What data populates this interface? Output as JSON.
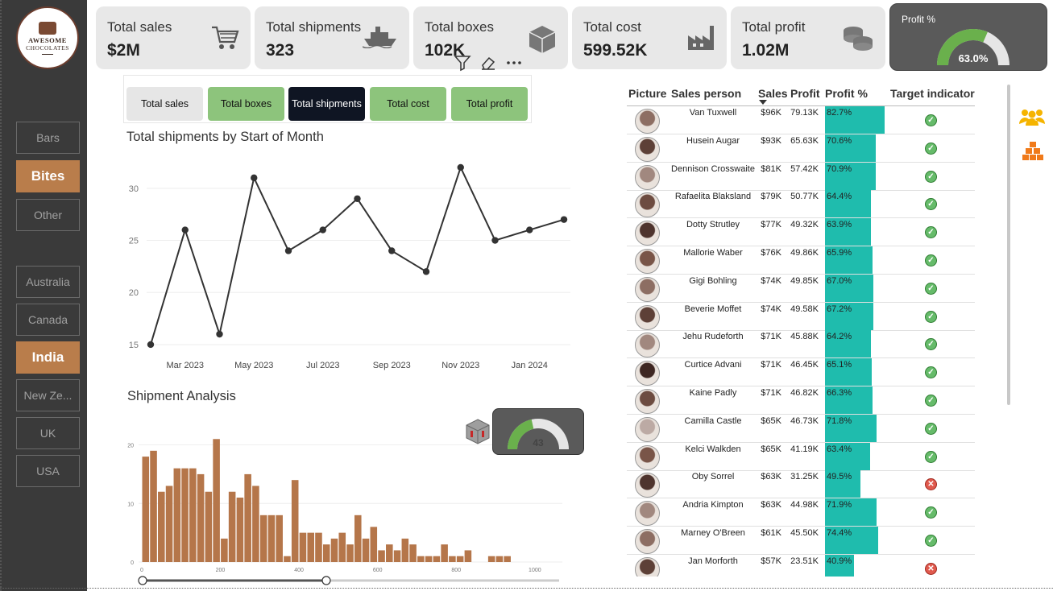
{
  "logo": {
    "line1": "AWESOME",
    "line2": "CHOCOLATES"
  },
  "product_slicer": [
    {
      "label": "Bars",
      "selected": false
    },
    {
      "label": "Bites",
      "selected": true
    },
    {
      "label": "Other",
      "selected": false
    }
  ],
  "country_slicer": [
    {
      "label": "Australia",
      "selected": false
    },
    {
      "label": "Canada",
      "selected": false
    },
    {
      "label": "India",
      "selected": true
    },
    {
      "label": "New Ze...",
      "selected": false
    },
    {
      "label": "UK",
      "selected": false
    },
    {
      "label": "USA",
      "selected": false
    }
  ],
  "kpis": [
    {
      "label": "Total sales",
      "value": "$2M",
      "icon": "shopping-cart-icon"
    },
    {
      "label": "Total shipments",
      "value": "323",
      "icon": "ship-icon"
    },
    {
      "label": "Total boxes",
      "value": "102K",
      "icon": "box-icon"
    },
    {
      "label": "Total cost",
      "value": "599.52K",
      "icon": "factory-icon"
    },
    {
      "label": "Total profit",
      "value": "1.02M",
      "icon": "coins-icon"
    }
  ],
  "profit_gauge": {
    "label": "Profit %",
    "value": "63.0%",
    "fraction": 0.63
  },
  "metric_tabs": [
    {
      "label": "Total sales",
      "style": "grey"
    },
    {
      "label": "Total boxes",
      "style": "green"
    },
    {
      "label": "Total shipments",
      "style": "dark"
    },
    {
      "label": "Total cost",
      "style": "green"
    },
    {
      "label": "Total profit",
      "style": "green"
    }
  ],
  "line_chart_title": "Total  shipments by Start of Month",
  "bar_chart_title": "Shipment Analysis",
  "shipment_gauge": {
    "value": "43",
    "fraction": 0.43
  },
  "chart_data": [
    {
      "type": "line",
      "title": "Total  shipments by Start of Month",
      "x": [
        "Feb 2023",
        "Mar 2023",
        "Apr 2023",
        "May 2023",
        "Jun 2023",
        "Jul 2023",
        "Aug 2023",
        "Sep 2023",
        "Oct 2023",
        "Nov 2023",
        "Dec 2023",
        "Jan 2024",
        "Feb 2024"
      ],
      "x_tick_labels": [
        "Mar 2023",
        "May 2023",
        "Jul 2023",
        "Sep 2023",
        "Nov 2023",
        "Jan 2024"
      ],
      "values": [
        15,
        26,
        16,
        31,
        24,
        26,
        29,
        24,
        22,
        32,
        25,
        26,
        27
      ],
      "y_ticks": [
        15,
        20,
        25,
        30
      ],
      "ylim": [
        14.3,
        33
      ],
      "color": "#333333",
      "grid": true
    },
    {
      "type": "bar",
      "title": "Shipment Analysis",
      "x_ticks": [
        0,
        200,
        400,
        600,
        800,
        1000
      ],
      "xlim": [
        -8,
        1070
      ],
      "y_ticks": [
        0,
        10,
        20
      ],
      "ylim": [
        0,
        22
      ],
      "bin_width": 20,
      "values": [
        18,
        19,
        12,
        13,
        16,
        16,
        16,
        15,
        12,
        21,
        4,
        12,
        11,
        15,
        13,
        8,
        8,
        8,
        1,
        14,
        5,
        5,
        5,
        3,
        4,
        5,
        3,
        8,
        4,
        6,
        2,
        3,
        2,
        4,
        3,
        1,
        1,
        1,
        3,
        1,
        1,
        2,
        0,
        0,
        1,
        1,
        1,
        0,
        0,
        0,
        0,
        0,
        0,
        0,
        0,
        0,
        0,
        0,
        0,
        0,
        0,
        0,
        0,
        0,
        0,
        0,
        0,
        0,
        0,
        0,
        0,
        0,
        0,
        0,
        0,
        0,
        0,
        0,
        0,
        0,
        0,
        0,
        0,
        0,
        0,
        0,
        0,
        0,
        0,
        0,
        0,
        0,
        0,
        0,
        0,
        0,
        0,
        0,
        0,
        0,
        0,
        0,
        0,
        0,
        0,
        0,
        0
      ],
      "color": "#b5764a"
    }
  ],
  "sales_table": {
    "headers": {
      "picture": "Picture",
      "person": "Sales person",
      "sales": "Sales",
      "profit": "Profit",
      "profit_pct": "Profit %",
      "target": "Target indicator"
    },
    "rows": [
      {
        "name": "Van Tuxwell",
        "sales": "$96K",
        "profit": "79.13K",
        "pct": "82.7%",
        "frac": 0.827,
        "ok": true
      },
      {
        "name": "Husein Augar",
        "sales": "$93K",
        "profit": "65.63K",
        "pct": "70.6%",
        "frac": 0.706,
        "ok": true
      },
      {
        "name": "Dennison Crosswaite",
        "sales": "$81K",
        "profit": "57.42K",
        "pct": "70.9%",
        "frac": 0.709,
        "ok": true
      },
      {
        "name": "Rafaelita Blaksland",
        "sales": "$79K",
        "profit": "50.77K",
        "pct": "64.4%",
        "frac": 0.644,
        "ok": true
      },
      {
        "name": "Dotty Strutley",
        "sales": "$77K",
        "profit": "49.32K",
        "pct": "63.9%",
        "frac": 0.639,
        "ok": true
      },
      {
        "name": "Mallorie Waber",
        "sales": "$76K",
        "profit": "49.86K",
        "pct": "65.9%",
        "frac": 0.659,
        "ok": true
      },
      {
        "name": "Gigi Bohling",
        "sales": "$74K",
        "profit": "49.85K",
        "pct": "67.0%",
        "frac": 0.67,
        "ok": true
      },
      {
        "name": "Beverie Moffet",
        "sales": "$74K",
        "profit": "49.58K",
        "pct": "67.2%",
        "frac": 0.672,
        "ok": true
      },
      {
        "name": "Jehu Rudeforth",
        "sales": "$71K",
        "profit": "45.88K",
        "pct": "64.2%",
        "frac": 0.642,
        "ok": true
      },
      {
        "name": "Curtice Advani",
        "sales": "$71K",
        "profit": "46.45K",
        "pct": "65.1%",
        "frac": 0.651,
        "ok": true
      },
      {
        "name": "Kaine Padly",
        "sales": "$71K",
        "profit": "46.82K",
        "pct": "66.3%",
        "frac": 0.663,
        "ok": true
      },
      {
        "name": "Camilla Castle",
        "sales": "$65K",
        "profit": "46.73K",
        "pct": "71.8%",
        "frac": 0.718,
        "ok": true
      },
      {
        "name": "Kelci Walkden",
        "sales": "$65K",
        "profit": "41.19K",
        "pct": "63.4%",
        "frac": 0.634,
        "ok": true
      },
      {
        "name": "Oby Sorrel",
        "sales": "$63K",
        "profit": "31.25K",
        "pct": "49.5%",
        "frac": 0.495,
        "ok": false
      },
      {
        "name": "Andria Kimpton",
        "sales": "$63K",
        "profit": "44.98K",
        "pct": "71.9%",
        "frac": 0.719,
        "ok": true
      },
      {
        "name": "Marney O'Breen",
        "sales": "$61K",
        "profit": "45.50K",
        "pct": "74.4%",
        "frac": 0.744,
        "ok": true
      },
      {
        "name": "Jan Morforth",
        "sales": "$57K",
        "profit": "23.51K",
        "pct": "40.9%",
        "frac": 0.409,
        "ok": false
      }
    ]
  },
  "colors": {
    "accent_brown": "#b97d4b",
    "teal_bar": "#1fbcad",
    "gauge_green": "#6ab04c",
    "tab_green": "#8dc47c"
  }
}
